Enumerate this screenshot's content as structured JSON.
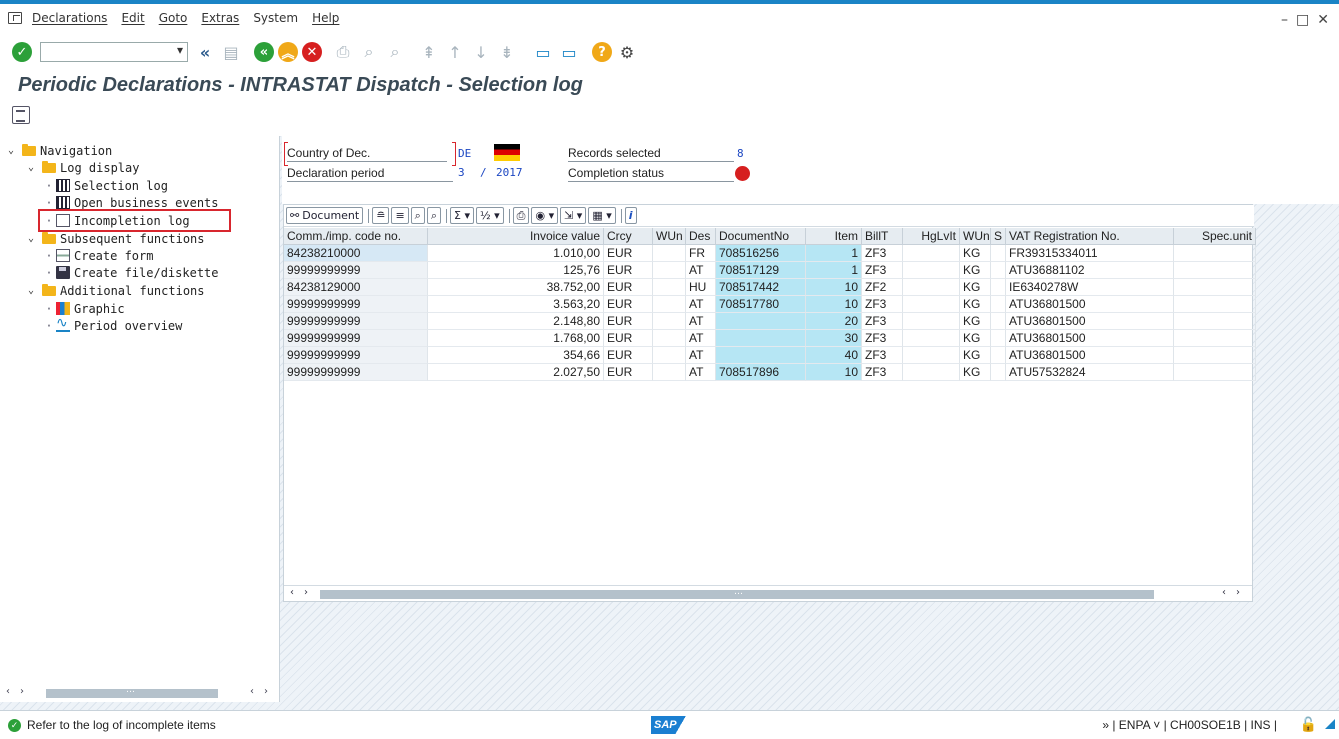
{
  "menubar": {
    "items": [
      "Declarations",
      "Edit",
      "Goto",
      "Extras",
      "System",
      "Help"
    ]
  },
  "title": "Periodic Declarations - INTRASTAT Dispatch - Selection log",
  "navigation": {
    "items": [
      {
        "label": "Navigation",
        "type": "folder",
        "level": 0
      },
      {
        "label": "Log display",
        "type": "folder",
        "level": 1
      },
      {
        "label": "Selection log",
        "type": "leaf",
        "icon": "table-icon",
        "level": 2
      },
      {
        "label": "Open business events",
        "type": "leaf",
        "icon": "table-icon",
        "level": 2
      },
      {
        "label": "Incompletion log",
        "type": "leaf",
        "icon": "document-icon",
        "level": 2
      },
      {
        "label": "Subsequent functions",
        "type": "folder",
        "level": 1
      },
      {
        "label": "Create form",
        "type": "leaf",
        "icon": "form-icon",
        "level": 2
      },
      {
        "label": "Create file/diskette",
        "type": "leaf",
        "icon": "disk-icon",
        "level": 2
      },
      {
        "label": "Additional functions",
        "type": "folder",
        "level": 1
      },
      {
        "label": "Graphic",
        "type": "leaf",
        "icon": "graphic-icon",
        "level": 2
      },
      {
        "label": "Period overview",
        "type": "leaf",
        "icon": "period-icon",
        "level": 2
      }
    ],
    "scroll_mid": "…"
  },
  "header": {
    "country_label": "Country of Dec.",
    "country_value": "DE",
    "period_label": "Declaration period",
    "period_month": "3",
    "period_sep": "/",
    "period_year": "2017",
    "records_label": "Records selected",
    "records_value": "8",
    "completion_label": "Completion status",
    "status_color": "#d61f1f"
  },
  "alv": {
    "toolbar": {
      "document_label": "Document"
    },
    "columns": [
      "Comm./imp. code no.",
      "Invoice value",
      "Crcy",
      "WUn",
      "Des",
      "DocumentNo",
      "Item",
      "BillT",
      "HgLvIt",
      "WUn",
      "S",
      "VAT Registration No.",
      "Spec.unit"
    ],
    "rows": [
      [
        "84238210000",
        "1.010,00",
        "EUR",
        "",
        "FR",
        "708516256",
        "1",
        "ZF3",
        "",
        "KG",
        "",
        "FR39315334011",
        ""
      ],
      [
        "99999999999",
        "125,76",
        "EUR",
        "",
        "AT",
        "708517129",
        "1",
        "ZF3",
        "",
        "KG",
        "",
        "ATU36881102",
        ""
      ],
      [
        "84238129000",
        "38.752,00",
        "EUR",
        "",
        "HU",
        "708517442",
        "10",
        "ZF2",
        "",
        "KG",
        "",
        "IE6340278W",
        ""
      ],
      [
        "99999999999",
        "3.563,20",
        "EUR",
        "",
        "AT",
        "708517780",
        "10",
        "ZF3",
        "",
        "KG",
        "",
        "ATU36801500",
        ""
      ],
      [
        "99999999999",
        "2.148,80",
        "EUR",
        "",
        "AT",
        "",
        "20",
        "ZF3",
        "",
        "KG",
        "",
        "ATU36801500",
        ""
      ],
      [
        "99999999999",
        "1.768,00",
        "EUR",
        "",
        "AT",
        "",
        "30",
        "ZF3",
        "",
        "KG",
        "",
        "ATU36801500",
        ""
      ],
      [
        "99999999999",
        "354,66",
        "EUR",
        "",
        "AT",
        "",
        "40",
        "ZF3",
        "",
        "KG",
        "",
        "ATU36801500",
        ""
      ],
      [
        "99999999999",
        "2.027,50",
        "EUR",
        "",
        "AT",
        "708517896",
        "10",
        "ZF3",
        "",
        "KG",
        "",
        "ATU57532824",
        ""
      ]
    ],
    "scroll_mid": "…"
  },
  "statusbar": {
    "message": "Refer to the log of incomplete items",
    "logo": "SAP",
    "system_info": "» | ENPA ˅ | CH00SOE1B | INS |"
  }
}
